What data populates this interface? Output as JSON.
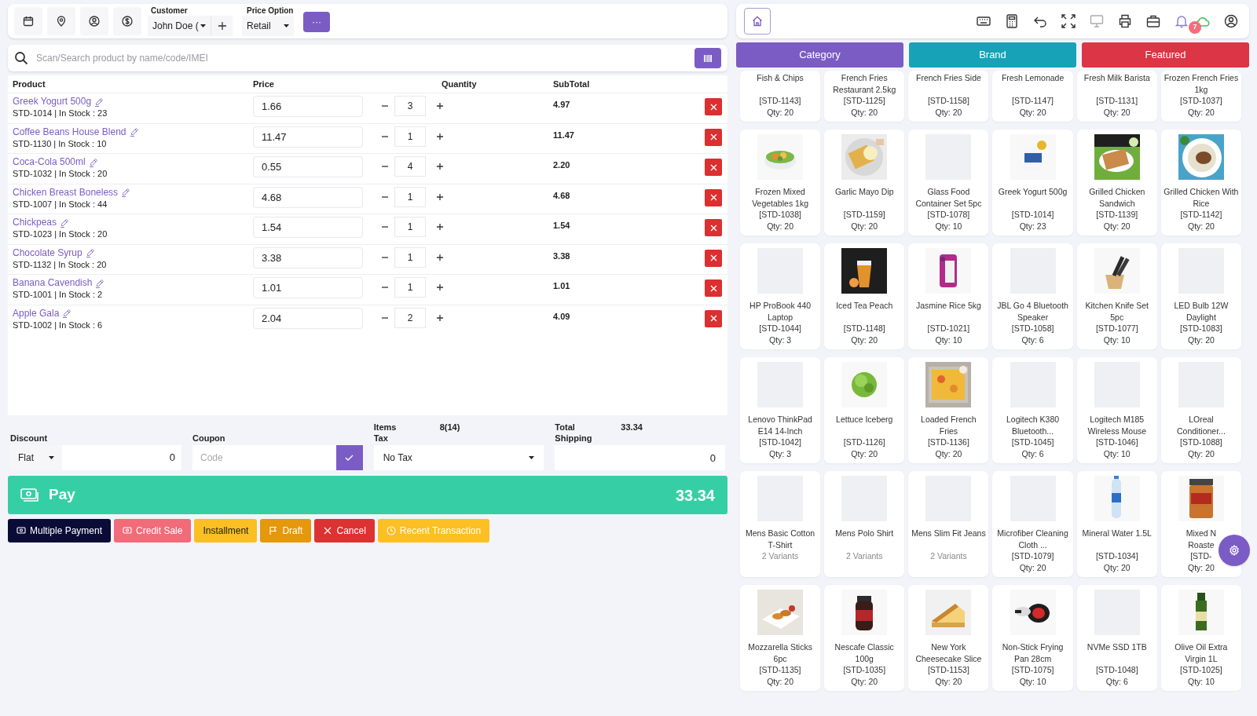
{
  "toolbar": {
    "customer": {
      "label": "Customer",
      "value": "John Doe ("
    },
    "price_option": {
      "label": "Price Option",
      "value": "Retail"
    },
    "more": "···"
  },
  "search": {
    "placeholder": "Scan/Search product by name/code/IMEI"
  },
  "cart": {
    "columns": [
      "Product",
      "Price",
      "Quantity",
      "SubTotal"
    ],
    "rows": [
      {
        "name": "Greek Yogurt 500g",
        "meta": "STD-1014 | In Stock : 23",
        "price": "1.66",
        "qty": "3",
        "subtotal": "4.97"
      },
      {
        "name": "Coffee Beans House Blend",
        "meta": "STD-1130 | In Stock : 10",
        "price": "11.47",
        "qty": "1",
        "subtotal": "11.47"
      },
      {
        "name": "Coca-Cola 500ml",
        "meta": "STD-1032 | In Stock : 20",
        "price": "0.55",
        "qty": "4",
        "subtotal": "2.20"
      },
      {
        "name": "Chicken Breast Boneless",
        "meta": "STD-1007 | In Stock : 44",
        "price": "4.68",
        "qty": "1",
        "subtotal": "4.68"
      },
      {
        "name": "Chickpeas",
        "meta": "STD-1023 | In Stock : 20",
        "price": "1.54",
        "qty": "1",
        "subtotal": "1.54"
      },
      {
        "name": "Chocolate Syrup",
        "meta": "STD-1132 | In Stock : 20",
        "price": "3.38",
        "qty": "1",
        "subtotal": "3.38"
      },
      {
        "name": "Banana Cavendish",
        "meta": "STD-1001 | In Stock : 2",
        "price": "1.01",
        "qty": "1",
        "subtotal": "1.01"
      },
      {
        "name": "Apple Gala",
        "meta": "STD-1002 | In Stock : 6",
        "price": "2.04",
        "qty": "2",
        "subtotal": "4.09"
      }
    ]
  },
  "summary": {
    "items_label": "Items",
    "items": "8(14)",
    "total_label": "Total",
    "total": "33.34",
    "discount_label": "Discount",
    "discount_type": "Flat",
    "discount": "0",
    "coupon_label": "Coupon",
    "coupon_placeholder": "Code",
    "tax_label": "Tax",
    "tax": "No Tax",
    "shipping_label": "Shipping",
    "shipping": "0"
  },
  "pay": {
    "label": "Pay",
    "amount": "33.34"
  },
  "actions": [
    {
      "label": "Multiple Payment",
      "kind": "cash",
      "color": "#0b0b38"
    },
    {
      "label": "Credit Sale",
      "kind": "cash",
      "color": "#f26b78"
    },
    {
      "label": "Installment",
      "kind": "plain",
      "color": "#fbbf24"
    },
    {
      "label": "Draft",
      "kind": "flag",
      "color": "#e5980c"
    },
    {
      "label": "Cancel",
      "kind": "close",
      "color": "#dc3232"
    },
    {
      "label": "Recent Transaction",
      "kind": "clock",
      "color": "#fcbf24"
    }
  ],
  "notifications": {
    "count": "7"
  },
  "tabs": [
    {
      "label": "Category",
      "color": "#7b5cc4"
    },
    {
      "label": "Brand",
      "color": "#17a2b8"
    },
    {
      "label": "Featured",
      "color": "#dc3545"
    }
  ],
  "products": [
    {
      "name": "Fish & Chips",
      "code": "[STD-1143]",
      "qty": "Qty: 20"
    },
    {
      "name": "French Fries Restaurant 2.5kg",
      "code": "[STD-1125]",
      "qty": "Qty: 20"
    },
    {
      "name": "French Fries Side",
      "code": "[STD-1158]",
      "qty": "Qty: 20"
    },
    {
      "name": "Fresh Lemonade",
      "code": "[STD-1147]",
      "qty": "Qty: 20"
    },
    {
      "name": "Fresh Milk Barista",
      "code": "[STD-1131]",
      "qty": "Qty: 20"
    },
    {
      "name": "Frozen French Fries 1kg",
      "code": "[STD-1037]",
      "qty": "Qty: 20"
    },
    {
      "kind": "picture",
      "name": "Frozen Mixed Vegetables 1kg",
      "code": "[STD-1038]",
      "qty": "Qty: 20"
    },
    {
      "kind": "picture",
      "name": "Garlic Mayo Dip",
      "code": "[STD-1159]",
      "qty": "Qty: 20"
    },
    {
      "kind": "placeholder",
      "name": "Glass Food Container Set 5pc",
      "code": "[STD-1078]",
      "qty": "Qty: 10"
    },
    {
      "kind": "picture",
      "name": "Greek Yogurt 500g",
      "code": "[STD-1014]",
      "qty": "Qty: 23"
    },
    {
      "kind": "picture",
      "name": "Grilled Chicken Sandwich",
      "code": "[STD-1139]",
      "qty": "Qty: 20"
    },
    {
      "kind": "picture",
      "name": "Grilled Chicken With Rice",
      "code": "[STD-1142]",
      "qty": "Qty: 20"
    },
    {
      "kind": "placeholder",
      "name": "HP ProBook 440 Laptop",
      "code": "[STD-1044]",
      "qty": "Qty: 3"
    },
    {
      "kind": "picture",
      "name": "Iced Tea Peach",
      "code": "[STD-1148]",
      "qty": "Qty: 20"
    },
    {
      "kind": "picture",
      "name": "Jasmine Rice 5kg",
      "code": "[STD-1021]",
      "qty": "Qty: 10"
    },
    {
      "kind": "placeholder",
      "name": "JBL Go 4 Bluetooth Speaker",
      "code": "[STD-1058]",
      "qty": "Qty: 6"
    },
    {
      "kind": "picture",
      "name": "Kitchen Knife Set 5pc",
      "code": "[STD-1077]",
      "qty": "Qty: 10"
    },
    {
      "kind": "placeholder",
      "name": "LED Bulb 12W Daylight",
      "code": "[STD-1083]",
      "qty": "Qty: 20"
    },
    {
      "kind": "placeholder",
      "name": "Lenovo ThinkPad E14 14-Inch",
      "code": "[STD-1042]",
      "qty": "Qty: 3"
    },
    {
      "kind": "picture",
      "name": "Lettuce Iceberg",
      "code": "[STD-1126]",
      "qty": "Qty: 20"
    },
    {
      "kind": "picture",
      "name": "Loaded French Fries",
      "code": "[STD-1136]",
      "qty": "Qty: 20"
    },
    {
      "kind": "placeholder",
      "name": "Logitech K380 Bluetooth...",
      "code": "[STD-1045]",
      "qty": "Qty: 6"
    },
    {
      "kind": "placeholder",
      "name": "Logitech M185 Wireless Mouse",
      "code": "[STD-1046]",
      "qty": "Qty: 10"
    },
    {
      "kind": "placeholder",
      "name": "LOreal Conditioner...",
      "code": "[STD-1088]",
      "qty": "Qty: 20"
    },
    {
      "kind": "placeholder",
      "name": "Mens Basic Cotton T-Shirt",
      "variants": "2 Variants"
    },
    {
      "kind": "placeholder",
      "name": "Mens Polo Shirt",
      "variants": "2 Variants"
    },
    {
      "kind": "placeholder",
      "name": "Mens Slim Fit Jeans",
      "variants": "2 Variants"
    },
    {
      "kind": "placeholder",
      "name": "Microfiber Cleaning Cloth ...",
      "code": "[STD-1079]",
      "qty": "Qty: 20"
    },
    {
      "kind": "picture",
      "name": "Mineral Water 1.5L",
      "code": "[STD-1034]",
      "qty": "Qty: 20"
    },
    {
      "kind": "picture",
      "name": "Mixed N\nRoaste",
      "code": "[STD-",
      "qty": "Qty: 20"
    },
    {
      "kind": "picture",
      "name": "Mozzarella Sticks 6pc",
      "code": "[STD-1135]",
      "qty": "Qty: 20"
    },
    {
      "kind": "picture",
      "name": "Nescafe Classic 100g",
      "code": "[STD-1035]",
      "qty": "Qty: 20"
    },
    {
      "kind": "picture",
      "name": "New York Cheesecake Slice",
      "code": "[STD-1153]",
      "qty": "Qty: 20"
    },
    {
      "kind": "picture",
      "name": "Non-Stick Frying Pan 28cm",
      "code": "[STD-1075]",
      "qty": "Qty: 10"
    },
    {
      "kind": "placeholder",
      "name": "NVMe SSD 1TB",
      "code": "[STD-1048]",
      "qty": "Qty: 6"
    },
    {
      "kind": "picture",
      "name": "Olive Oil Extra Virgin 1L",
      "code": "[STD-1025]",
      "qty": "Qty: 10"
    }
  ]
}
